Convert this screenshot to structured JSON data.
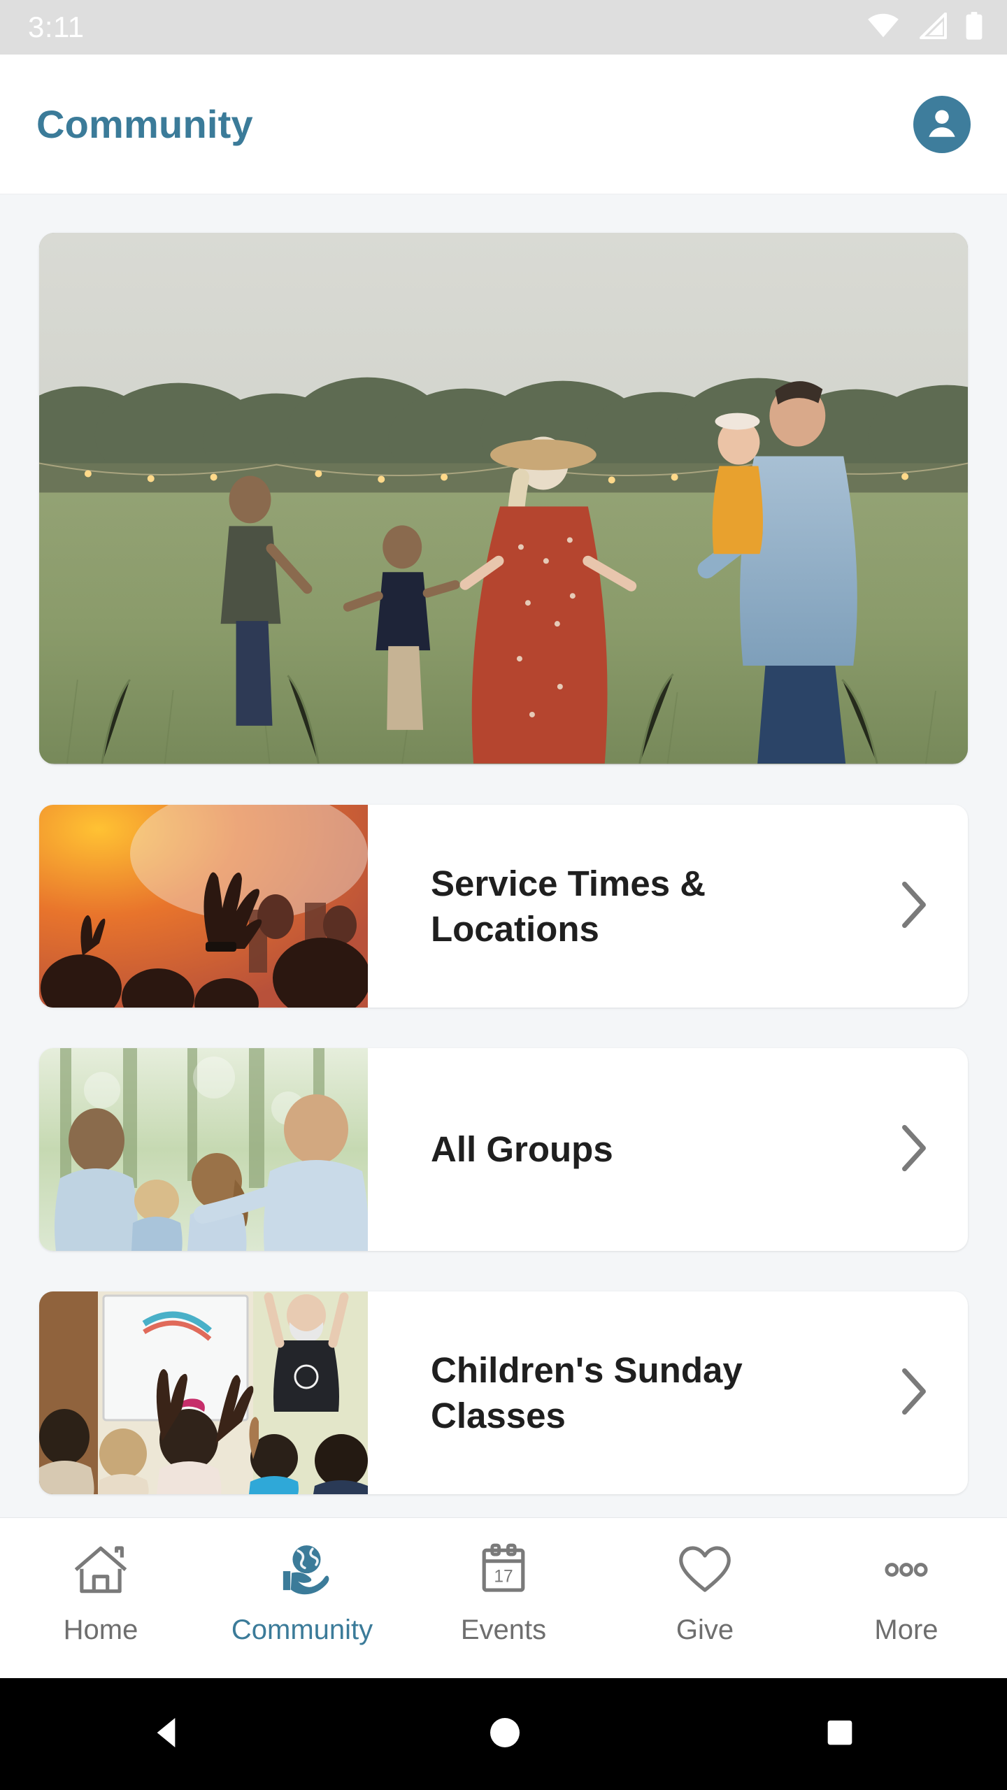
{
  "status_bar": {
    "time": "3:11",
    "icons": [
      "wifi-icon",
      "cellular-signal-icon",
      "battery-icon"
    ],
    "background": "#DEDEDE",
    "foreground": "#FFFFFF"
  },
  "header": {
    "title": "Community",
    "title_color": "#3B7B99",
    "avatar": {
      "icon": "account-avatar-icon",
      "background": "#3E7D9C"
    }
  },
  "hero": {
    "name": "community-hero-banner",
    "alt": "Family of five walking hand in hand through a grassy field at dusk with string lights along the treeline"
  },
  "cards": [
    {
      "title": "Service Times & Locations",
      "thumb": "worship-service-thumbnail",
      "chevron": "chevron-right-icon"
    },
    {
      "title": "All Groups",
      "thumb": "family-in-forest-thumbnail",
      "chevron": "chevron-right-icon"
    },
    {
      "title": "Children's Sunday Classes",
      "thumb": "children-classroom-thumbnail",
      "chevron": "chevron-right-icon"
    }
  ],
  "bottom_nav": {
    "active": "Community",
    "active_color": "#3B7B99",
    "inactive_color": "#6E6E6E",
    "items": [
      {
        "label": "Home",
        "icon": "home-icon"
      },
      {
        "label": "Community",
        "icon": "globe-in-hand-icon"
      },
      {
        "label": "Events",
        "icon": "calendar-icon",
        "badge": "17"
      },
      {
        "label": "Give",
        "icon": "heart-icon"
      },
      {
        "label": "More",
        "icon": "ellipsis-icon"
      }
    ]
  },
  "system_nav": {
    "background": "#000000",
    "items": [
      {
        "name": "back-button",
        "icon": "triangle-left-icon"
      },
      {
        "name": "home-button",
        "icon": "circle-icon"
      },
      {
        "name": "recents-button",
        "icon": "square-icon"
      }
    ]
  },
  "theme": {
    "page_background": "#F4F6F8",
    "card_background": "#FFFFFF",
    "accent": "#3B7B99",
    "title_text": "#1F1F1F",
    "chevron": "#7A7A7A"
  }
}
